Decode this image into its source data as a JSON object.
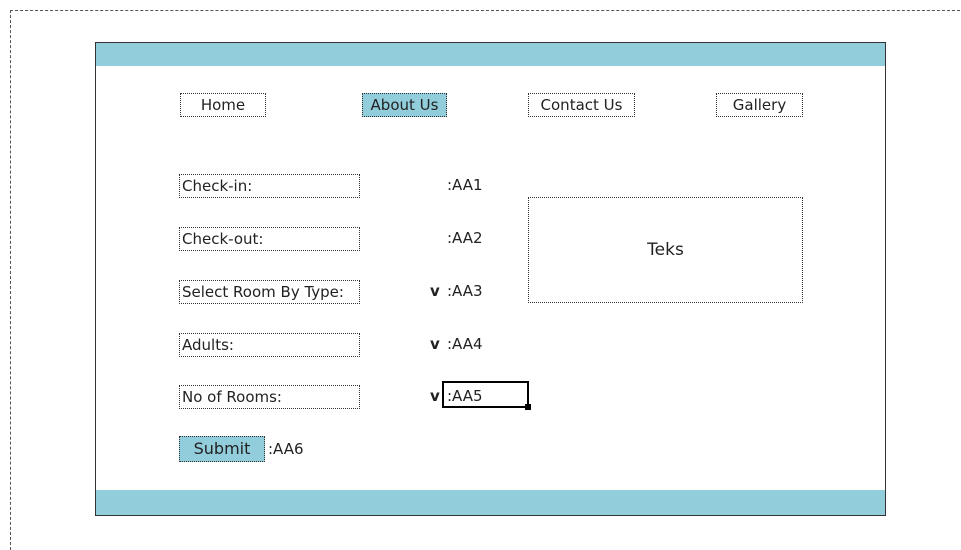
{
  "nav": {
    "items": [
      {
        "label": "Home",
        "active": false
      },
      {
        "label": "About Us",
        "active": true
      },
      {
        "label": "Contact Us",
        "active": false
      },
      {
        "label": "Gallery",
        "active": false
      }
    ]
  },
  "form": {
    "fields": [
      {
        "label": "Check-in:",
        "ref": ":AA1",
        "dropdown": ""
      },
      {
        "label": "Check-out:",
        "ref": ":AA2",
        "dropdown": ""
      },
      {
        "label": "Select Room By Type:",
        "ref": ":AA3",
        "dropdown": "v"
      },
      {
        "label": "Adults:",
        "ref": ":AA4",
        "dropdown": "v"
      },
      {
        "label": "No of Rooms:",
        "ref": ":AA5",
        "dropdown": "v"
      }
    ],
    "submit_label": "Submit",
    "submit_ref": ":AA6"
  },
  "text_box": {
    "label": "Teks"
  },
  "colors": {
    "accent": "#92cddb"
  }
}
